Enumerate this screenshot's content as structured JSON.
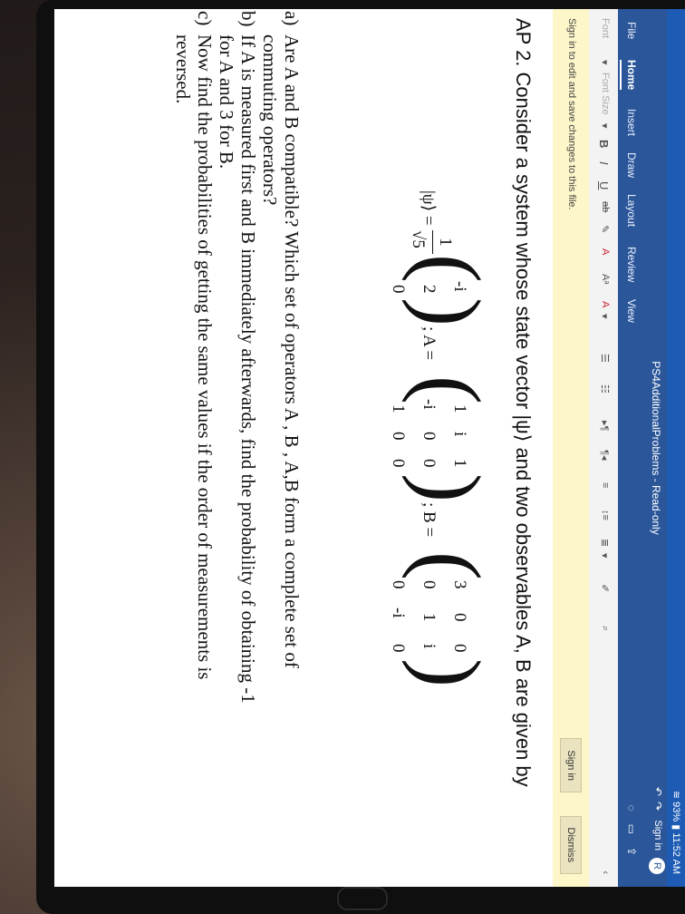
{
  "status": {
    "battery": "93%",
    "time": "11:52 AM"
  },
  "window": {
    "title": "PS4AdditionalProblems - Read-only",
    "sign_in": "Sign in",
    "avatar": "R"
  },
  "tabs": [
    "File",
    "Home",
    "Insert",
    "Draw",
    "Layout",
    "Review",
    "View"
  ],
  "ribbon": {
    "font_placeholder": "Font",
    "font_size_placeholder": "Font Size",
    "bold": "B",
    "italic": "I",
    "underline": "U",
    "strike": "ab",
    "format_a": "A",
    "arrow": "▾"
  },
  "notice": {
    "text": "Sign in to edit and save changes to this file.",
    "sign_in_button": "Sign in",
    "dismiss_button": "Dismiss"
  },
  "document": {
    "heading": "AP 2. Consider a system whose state vector |ψ⟩ and two observables A, B are given by",
    "math": {
      "psi": "|ψ⟩ =",
      "frac_num": "1",
      "frac_den": "√5",
      "psi_vec": [
        "-i",
        "2",
        "0"
      ],
      "a_label": "; A =",
      "A": [
        [
          "1",
          "i",
          "1"
        ],
        [
          "-i",
          "0",
          "0"
        ],
        [
          "1",
          "0",
          "0"
        ]
      ],
      "b_label": "; B =",
      "B": [
        [
          "3",
          "0",
          "0"
        ],
        [
          "0",
          "1",
          "i"
        ],
        [
          "0",
          "-i",
          "0"
        ]
      ]
    },
    "questions": [
      {
        "label": "a)",
        "lines": [
          "Are A and B compatible? Which set of operators  A ,  B ,  A,B  form a complete set of",
          "commuting operators?"
        ]
      },
      {
        "label": "b)",
        "lines": [
          "If A is measured first and B immediately afterwards, find the probability of obtaining -1",
          "for A and 3 for B."
        ]
      },
      {
        "label": "c)",
        "lines": [
          "Now find the probabilities of getting the same values if the order of measurements is",
          "reversed."
        ]
      }
    ]
  }
}
